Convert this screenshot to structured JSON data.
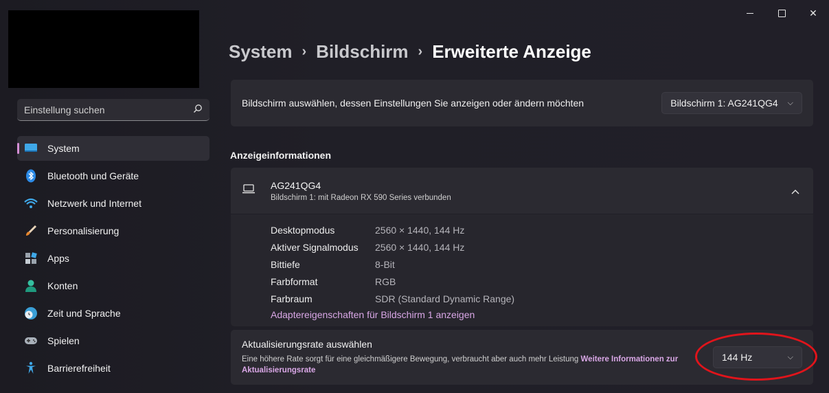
{
  "search": {
    "placeholder": "Einstellung suchen"
  },
  "sidebar": {
    "items": [
      {
        "label": "System",
        "icon": "system-icon",
        "active": true
      },
      {
        "label": "Bluetooth und Geräte",
        "icon": "bluetooth-icon"
      },
      {
        "label": "Netzwerk und Internet",
        "icon": "wifi-icon"
      },
      {
        "label": "Personalisierung",
        "icon": "brush-icon"
      },
      {
        "label": "Apps",
        "icon": "apps-icon"
      },
      {
        "label": "Konten",
        "icon": "account-icon"
      },
      {
        "label": "Zeit und Sprache",
        "icon": "clock-globe-icon"
      },
      {
        "label": "Spielen",
        "icon": "gamepad-icon"
      },
      {
        "label": "Barrierefreiheit",
        "icon": "accessibility-icon"
      }
    ]
  },
  "breadcrumb": {
    "level1": "System",
    "level2": "Bildschirm",
    "current": "Erweiterte Anzeige"
  },
  "display_select": {
    "label": "Bildschirm auswählen, dessen Einstellungen Sie anzeigen oder ändern möchten",
    "value": "Bildschirm 1: AG241QG4"
  },
  "section_title": "Anzeigeinformationen",
  "monitor": {
    "name": "AG241QG4",
    "subtitle": "Bildschirm 1: mit Radeon RX 590 Series verbunden",
    "rows": [
      {
        "key": "Desktopmodus",
        "value": "2560 × 1440, 144 Hz"
      },
      {
        "key": "Aktiver Signalmodus",
        "value": "2560 × 1440, 144 Hz"
      },
      {
        "key": "Bittiefe",
        "value": "8-Bit"
      },
      {
        "key": "Farbformat",
        "value": "RGB"
      },
      {
        "key": "Farbraum",
        "value": "SDR (Standard Dynamic Range)"
      }
    ],
    "link": "Adaptereigenschaften für Bildschirm 1 anzeigen"
  },
  "refresh": {
    "title": "Aktualisierungsrate auswählen",
    "desc": "Eine höhere Rate sorgt für eine gleichmäßigere Bewegung, verbraucht aber auch mehr Leistung",
    "link": "Weitere Informationen zur Aktualisierungsrate",
    "value": "144 Hz"
  },
  "colors": {
    "accent": "#d58fd6",
    "annotation": "#e0141b"
  }
}
